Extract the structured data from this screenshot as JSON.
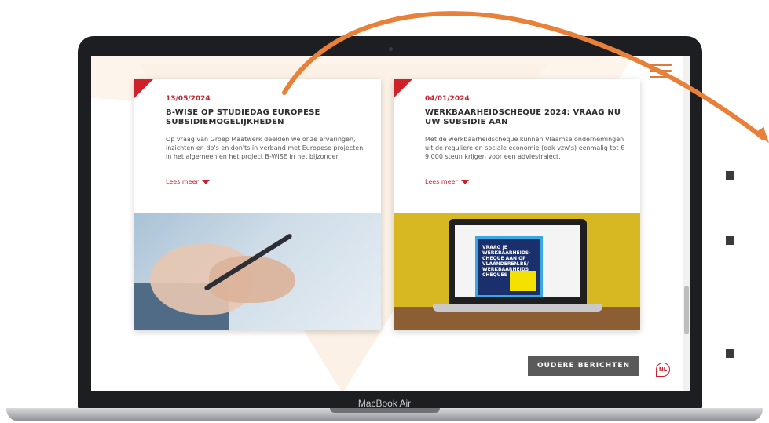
{
  "device": {
    "model_label": "MacBook Air"
  },
  "header": {
    "menu_icon": "hamburger-menu-icon",
    "accent_color": "#e07a3b"
  },
  "cards": [
    {
      "date": "13/05/2024",
      "title": "B-WISE OP STUDIEDAG EUROPESE SUBSIDIEMOGELIJKHEDEN",
      "text": "Op vraag van Groep Maatwerk deelden we onze ervaringen, inzichten en do's en don'ts in verband met Europese projecten in het algemeen en het project B-WISE in het bijzonder.",
      "read_more": "Lees meer"
    },
    {
      "date": "04/01/2024",
      "title": "WERKBAARHEIDSCHEQUE 2024: VRAAG NU UW SUBSIDIE AAN",
      "text": "Met de werkbaarheidscheque kunnen Vlaamse ondernemingen uit de reguliere en sociale economie (ook vzw's) eenmalig tot € 9.000 steun krijgen voor een adviestraject.",
      "read_more": "Lees meer",
      "image_text": "VRAAG JE WERKBAARHEIDS-CHEQUE AAN OP VLAANDEREN.BE/ WERKBAARHEIDS CHEQUES"
    }
  ],
  "footer": {
    "older_posts": "OUDERE BERICHTEN",
    "language": "NL"
  },
  "colors": {
    "brand_red": "#c8202e",
    "button_gray": "#5a5a5a",
    "arrow_orange": "#e8803a"
  }
}
